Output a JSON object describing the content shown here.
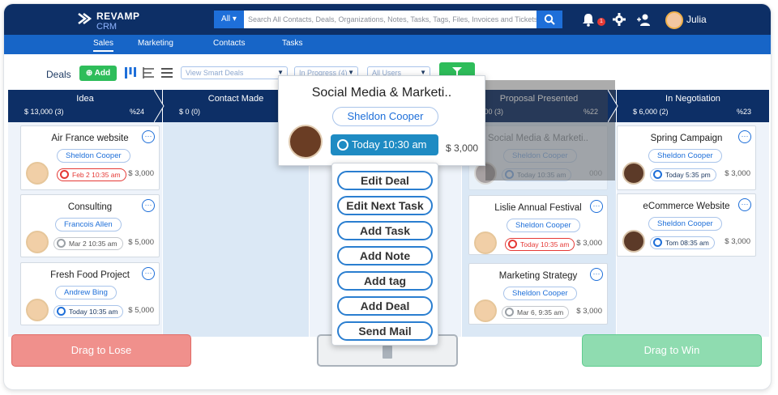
{
  "brand": {
    "name": "REVAMP",
    "sub": "CRM"
  },
  "search": {
    "scope": "All",
    "placeholder": "Search All Contacts, Deals, Organizations, Notes, Tasks, Tags, Files, Invoices and Tickets"
  },
  "header": {
    "notification_count": "1",
    "user_name": "Julia"
  },
  "subnav": [
    "Sales",
    "Marketing",
    "Contacts",
    "Tasks"
  ],
  "toolbar": {
    "deals_label": "Deals",
    "add_label": "Add",
    "smart_deals_placeholder": "View Smart Deals",
    "status_filter": "In Progress (4)",
    "user_filter": "All Users"
  },
  "stages": [
    {
      "name": "Idea",
      "amount": "$ 13,000 (3)",
      "percent": "%24"
    },
    {
      "name": "Contact Made",
      "amount": "$ 0 (0)",
      "percent": ""
    },
    {
      "name": "Proposal Presented",
      "amount": ",000 (3)",
      "percent": "%22"
    },
    {
      "name": "In Negotiation",
      "amount": "$ 6,000 (2)",
      "percent": "%23"
    }
  ],
  "cards": {
    "idea": [
      {
        "title": "Air France website",
        "owner": "Sheldon Cooper",
        "when": "Feb 2 10:35 am",
        "amount": "$ 3,000"
      },
      {
        "title": "Consulting",
        "owner": "Francois Allen",
        "when": "Mar 2 10:35 am",
        "amount": "$ 5,000"
      },
      {
        "title": "Fresh Food Project",
        "owner": "Andrew Bing",
        "when": "Today 10:35 am",
        "amount": "$ 5,000"
      }
    ],
    "proposal": [
      {
        "title": "Social Media & Marketi..",
        "owner": "Sheldon Cooper",
        "when": "Today 10:35 am",
        "amount": "000"
      },
      {
        "title": "Lislie Annual Festival",
        "owner": "Sheldon Cooper",
        "when": "Today 10:35 am",
        "amount": "$ 3,000"
      },
      {
        "title": "Marketing Strategy",
        "owner": "Sheldon Cooper",
        "when": "Mar 6, 9:35 am",
        "amount": "$ 3,000"
      }
    ],
    "negotiation": [
      {
        "title": "Spring Campaign",
        "owner": "Sheldon Cooper",
        "when": "Today 5:35 pm",
        "amount": "$ 3,000"
      },
      {
        "title": "eCommerce Website",
        "owner": "Sheldon Cooper",
        "when": "Tom 08:35 am",
        "amount": "$ 3,000"
      }
    ]
  },
  "popup": {
    "title": "Social Media & Marketi..",
    "owner": "Sheldon Cooper",
    "when": "Today 10:30 am",
    "amount": "$ 3,000"
  },
  "menu": [
    "Edit Deal",
    "Edit Next Task",
    "Add Task",
    "Add Note",
    "Add tag",
    "Add Deal",
    "Send  Mail"
  ],
  "drop_zones": {
    "lose": "Drag to Lose",
    "win": "Drag to Win"
  },
  "colors": {
    "navy": "#0d2f66",
    "blue": "#1765c7",
    "green": "#2ebd5a",
    "red": "#e53935"
  },
  "icons": [
    "search-icon",
    "bell-icon",
    "gear-icon",
    "add-user-icon",
    "trash-icon",
    "filter-icon",
    "clock-icon"
  ]
}
